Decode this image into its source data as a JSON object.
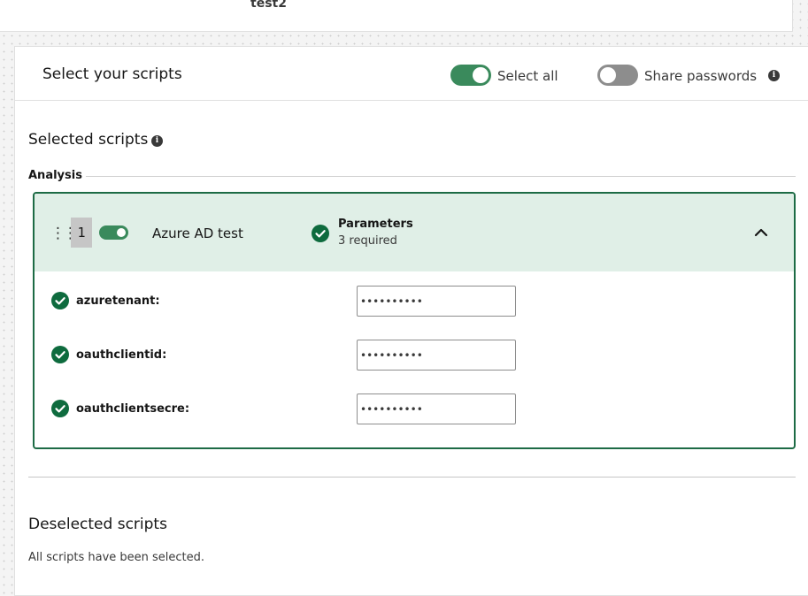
{
  "top_card": {
    "title": "test2"
  },
  "header": {
    "title": "Select your scripts",
    "select_all_label": "Select all",
    "select_all_on": true,
    "share_passwords_label": "Share passwords",
    "share_passwords_on": false,
    "info_icon": "info-icon"
  },
  "selected": {
    "title": "Selected scripts",
    "info_icon": "info-icon",
    "group_label": "Analysis",
    "script": {
      "order": "1",
      "enabled": true,
      "name": "Azure AD test",
      "parameters_title": "Parameters",
      "parameters_status": "3 required",
      "expanded": true,
      "params": [
        {
          "label": "azuretenant:",
          "value": "••••••••••"
        },
        {
          "label": "oauthclientid:",
          "value": "••••••••••"
        },
        {
          "label": "oauthclientsecre:",
          "value": "••••••••••"
        }
      ]
    }
  },
  "deselected": {
    "title": "Deselected scripts",
    "empty_text": "All scripts have been selected."
  },
  "colors": {
    "accent_green": "#0e6b3e",
    "card_header_bg": "#e0efe7",
    "toggle_on": "#3a8a5c",
    "toggle_off": "#8d8d8d"
  }
}
